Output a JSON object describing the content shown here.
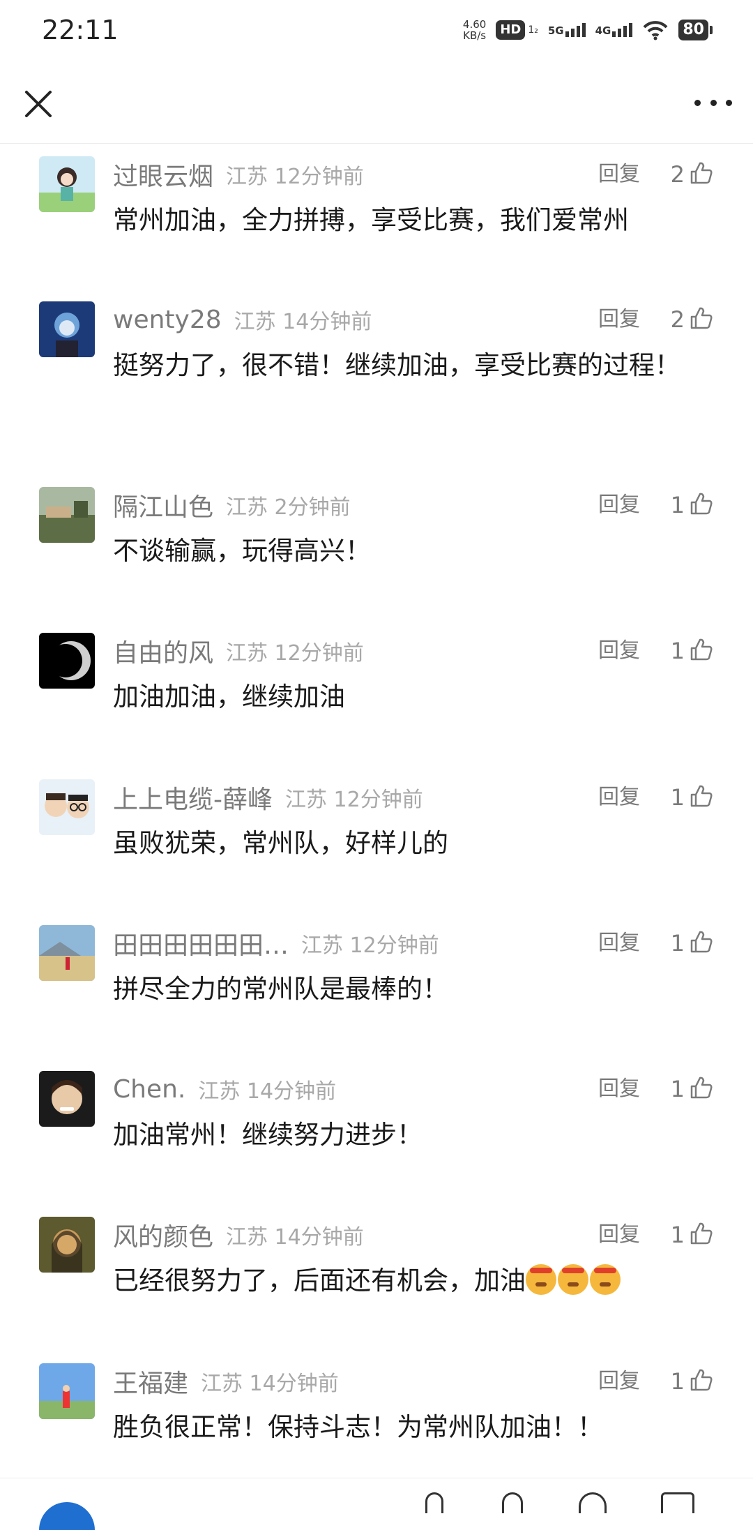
{
  "status_bar": {
    "time": "22:11",
    "net_speed_value": "4.60",
    "net_speed_unit": "KB/s",
    "hd_label": "HD",
    "hd_sub": "1₂",
    "sig1_label": "5G",
    "sig2_label": "4G",
    "battery": "80"
  },
  "nav": {
    "close_icon": "close-icon",
    "more_icon": "more-horizontal-icon"
  },
  "comments": [
    {
      "user": "过眼云烟",
      "meta": "江苏 12分钟前",
      "reply": "回复",
      "likes": "2",
      "text": "常州加油，全力拼搏，享受比赛，我们爱常州"
    },
    {
      "user": "wenty28",
      "meta": "江苏 14分钟前",
      "reply": "回复",
      "likes": "2",
      "text": "挺努力了，很不错！继续加油，享受比赛的过程！"
    },
    {
      "user": "隔江山色",
      "meta": "江苏 2分钟前",
      "reply": "回复",
      "likes": "1",
      "text": "不谈输赢，玩得高兴！"
    },
    {
      "user": "自由的风",
      "meta": "江苏 12分钟前",
      "reply": "回复",
      "likes": "1",
      "text": "加油加油，继续加油"
    },
    {
      "user": "上上电缆-薛峰",
      "meta": "江苏 12分钟前",
      "reply": "回复",
      "likes": "1",
      "text": "虽败犹荣，常州队，好样儿的"
    },
    {
      "user": "田田田田田田…",
      "meta": "江苏 12分钟前",
      "reply": "回复",
      "likes": "1",
      "text": "拼尽全力的常州队是最棒的！"
    },
    {
      "user": "Chen.",
      "meta": "江苏 14分钟前",
      "reply": "回复",
      "likes": "1",
      "text": "加油常州！继续努力进步！"
    },
    {
      "user": "风的颜色",
      "meta": "江苏 14分钟前",
      "reply": "回复",
      "likes": "1",
      "text": "已经很努力了，后面还有机会，加油"
    },
    {
      "user": "王福建",
      "meta": "江苏 14分钟前",
      "reply": "回复",
      "likes": "1",
      "text": "胜负很正常！保持斗志！为常州队加油！！"
    }
  ],
  "icons": {
    "like": "thumbs-up-icon",
    "emoji": "determined-face-emoji-icon"
  },
  "colors": {
    "username": "#7a7a7a",
    "meta": "#a8a8a8",
    "text": "#1a1a1a",
    "divider": "#ececec"
  }
}
